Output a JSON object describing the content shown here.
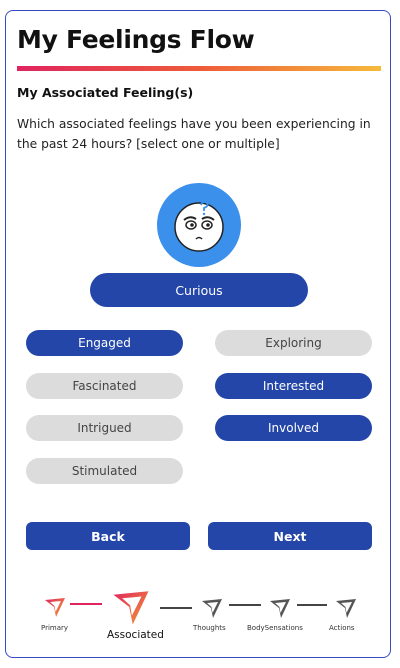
{
  "header": {
    "title": "My Feelings Flow",
    "subtitle": "My Associated Feeling(s)",
    "question": "Which associated feelings have you been experiencing in the past 24 hours? [select one or multiple]"
  },
  "primary_feeling": "Curious",
  "associated_feelings": [
    {
      "label": "Engaged",
      "selected": true
    },
    {
      "label": "Exploring",
      "selected": false
    },
    {
      "label": "Fascinated",
      "selected": false
    },
    {
      "label": "Interested",
      "selected": true
    },
    {
      "label": "Intrigued",
      "selected": false
    },
    {
      "label": "Involved",
      "selected": true
    },
    {
      "label": "Stimulated",
      "selected": false
    }
  ],
  "buttons": {
    "back": "Back",
    "next": "Next"
  },
  "steps": [
    {
      "label": "Primary",
      "state": "done"
    },
    {
      "label": "Associated",
      "state": "active"
    },
    {
      "label": "Thoughts",
      "state": "pending"
    },
    {
      "label": "BodySensations",
      "state": "pending"
    },
    {
      "label": "Actions",
      "state": "pending"
    }
  ],
  "colors": {
    "accent": "#2346a8",
    "chip_off": "#dcdcdc",
    "face_bg": "#3b90ec",
    "progress_start": "#e0245e",
    "progress_end": "#f6b93b"
  }
}
